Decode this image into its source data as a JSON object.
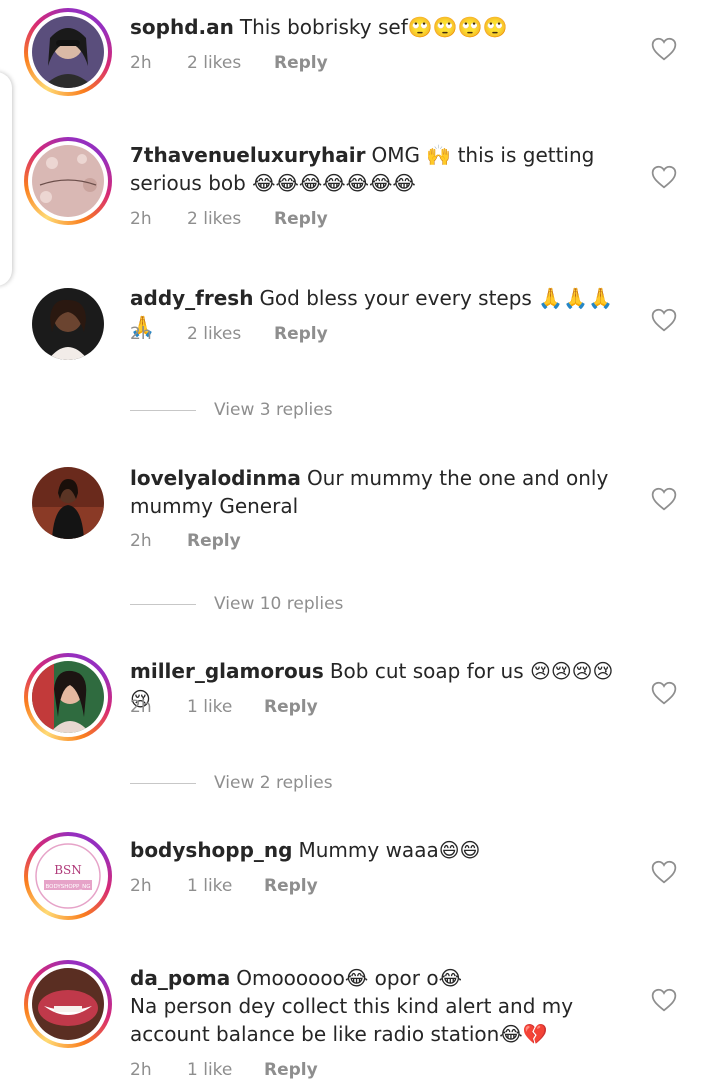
{
  "comments": [
    {
      "username": "sophd.an",
      "text": "This bobrisky sef🙄🙄🙄🙄",
      "time": "2h",
      "likes": "2 likes",
      "reply": "Reply"
    },
    {
      "username": "7thavenueluxuryhair",
      "text": "OMG 🙌 this is getting serious bob 😂😂😂😂😂😂😂",
      "time": "2h",
      "likes": "2 likes",
      "reply": "Reply"
    },
    {
      "username": "addy_fresh",
      "text": "God bless your every steps 🙏🙏🙏🙏",
      "time": "2h",
      "likes": "2 likes",
      "reply": "Reply",
      "view_replies": "View 3 replies"
    },
    {
      "username": "lovelyalodinma",
      "text": "Our mummy the one and only mummy General",
      "time": "2h",
      "likes": "",
      "reply": "Reply",
      "view_replies": "View 10 replies"
    },
    {
      "username": "miller_glamorous",
      "text": "Bob cut soap for us 😢😢😢😢😢",
      "time": "2h",
      "likes": "1 like",
      "reply": "Reply",
      "view_replies": "View 2 replies"
    },
    {
      "username": "bodyshopp_ng",
      "text": "Mummy waaa😄😄",
      "time": "2h",
      "likes": "1 like",
      "reply": "Reply",
      "avatar_text": "BODYSHOPP_NG"
    },
    {
      "username": "da_poma",
      "text": "Omoooooo😂 opor o😂\nNa person dey collect this kind alert and my account balance be like radio station😂💔",
      "time": "2h",
      "likes": "1 like",
      "reply": "Reply"
    }
  ]
}
